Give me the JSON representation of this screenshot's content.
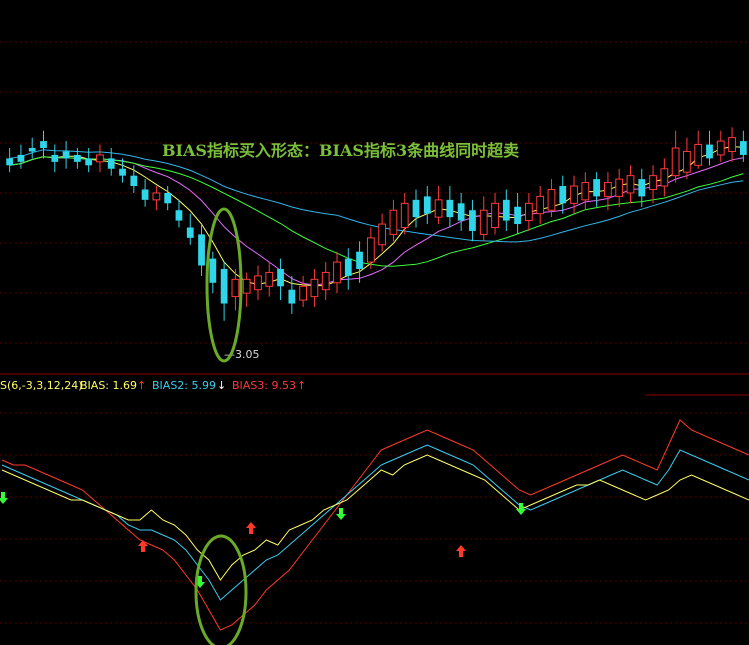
{
  "annotation": {
    "title": "BIAS指标买入形态：BIAS指标3条曲线同时超卖",
    "low_price_label": "—3.05"
  },
  "colors": {
    "background": "#000000",
    "grid": "#5a0000",
    "separator": "#8b0000",
    "candle_up": "#ff3a3a",
    "candle_down": "#2fd5e8",
    "ma_short": "#ffff66",
    "ma_mid": "#e66cff",
    "ma_long": "#3aff3a",
    "ma_longest": "#33b5e8",
    "title_color": "#7cbf3a",
    "ellipse": "#6aaa2a",
    "bias1": "#ffff66",
    "bias2": "#3acdf0",
    "bias3": "#ff3a2a",
    "arrow_up": "#ff3a2a",
    "arrow_down": "#33ff33"
  },
  "indicator_header": {
    "name_params": "S(6,-3,3,12,24)",
    "bias1_label": "BIAS: 1.69",
    "bias1_arrow": "↑",
    "bias2_label": "BIAS2: 5.99",
    "bias2_arrow": "↓",
    "bias3_label": "BIAS3: 9.53",
    "bias3_arrow": "↑"
  },
  "chart_data": [
    {
      "type": "candlestick",
      "title": "BIAS指标买入形态：BIAS指标3条曲线同时超卖",
      "annotation": "3.05",
      "candles": [
        [
          2,
          3.55,
          3.48,
          "d"
        ],
        [
          1,
          3.56,
          3.49,
          "d"
        ],
        [
          0,
          3.58,
          3.52,
          "d"
        ],
        [
          -1,
          3.6,
          3.52,
          "d"
        ],
        [
          1,
          3.56,
          3.48,
          "d"
        ],
        [
          -1,
          3.57,
          3.49,
          "d"
        ],
        [
          0,
          3.55,
          3.49,
          "d"
        ],
        [
          1,
          3.55,
          3.48,
          "d"
        ],
        [
          0,
          3.56,
          3.48,
          "u"
        ],
        [
          0,
          3.55,
          3.47,
          "d"
        ],
        [
          1,
          3.52,
          3.45,
          "d"
        ],
        [
          2,
          3.5,
          3.42,
          "d"
        ],
        [
          3,
          3.46,
          3.38,
          "d"
        ],
        [
          3,
          3.44,
          3.37,
          "u"
        ],
        [
          3,
          3.44,
          3.37,
          "d"
        ],
        [
          4,
          3.4,
          3.32,
          "d"
        ],
        [
          5,
          3.36,
          3.27,
          "d"
        ],
        [
          7,
          3.33,
          3.18,
          "d"
        ],
        [
          8,
          3.25,
          3.13,
          "d"
        ],
        [
          9,
          3.22,
          3.05,
          "d"
        ],
        [
          8,
          3.2,
          3.08,
          "u"
        ],
        [
          8,
          3.19,
          3.09,
          "u"
        ],
        [
          8,
          3.21,
          3.11,
          "u"
        ],
        [
          8,
          3.22,
          3.12,
          "u"
        ],
        [
          7,
          3.23,
          3.11,
          "d"
        ],
        [
          6,
          3.18,
          3.07,
          "d"
        ],
        [
          7,
          3.18,
          3.09,
          "u"
        ],
        [
          6,
          3.2,
          3.09,
          "u"
        ],
        [
          5,
          3.22,
          3.11,
          "u"
        ],
        [
          4,
          3.25,
          3.13,
          "u"
        ],
        [
          5,
          3.26,
          3.14,
          "d"
        ],
        [
          6,
          3.28,
          3.16,
          "d"
        ],
        [
          7,
          3.32,
          3.2,
          "u"
        ],
        [
          8,
          3.36,
          3.25,
          "u"
        ],
        [
          9,
          3.4,
          3.28,
          "u"
        ],
        [
          10,
          3.42,
          3.3,
          "u"
        ],
        [
          11,
          3.43,
          3.32,
          "d"
        ],
        [
          12,
          3.44,
          3.33,
          "d"
        ],
        [
          11,
          3.44,
          3.33,
          "u"
        ],
        [
          11,
          3.44,
          3.32,
          "d"
        ],
        [
          11,
          3.42,
          3.31,
          "d"
        ],
        [
          10,
          3.4,
          3.28,
          "d"
        ],
        [
          9,
          3.41,
          3.28,
          "u"
        ],
        [
          9,
          3.42,
          3.3,
          "u"
        ],
        [
          9,
          3.43,
          3.31,
          "d"
        ],
        [
          8,
          3.42,
          3.3,
          "d"
        ],
        [
          8,
          3.42,
          3.31,
          "u"
        ],
        [
          7,
          3.44,
          3.33,
          "u"
        ],
        [
          7,
          3.46,
          3.35,
          "u"
        ],
        [
          6,
          3.47,
          3.36,
          "d"
        ],
        [
          6,
          3.47,
          3.36,
          "u"
        ],
        [
          5,
          3.48,
          3.37,
          "u"
        ],
        [
          5,
          3.48,
          3.38,
          "d"
        ],
        [
          5,
          3.48,
          3.37,
          "u"
        ],
        [
          4,
          3.49,
          3.38,
          "u"
        ],
        [
          4,
          3.5,
          3.39,
          "u"
        ],
        [
          4,
          3.49,
          3.38,
          "d"
        ],
        [
          3,
          3.5,
          3.39,
          "u"
        ],
        [
          3,
          3.52,
          3.41,
          "u"
        ],
        [
          1,
          3.6,
          3.45,
          "u"
        ],
        [
          2,
          3.58,
          3.46,
          "u"
        ],
        [
          2,
          3.6,
          3.49,
          "u"
        ],
        [
          1,
          3.6,
          3.5,
          "d"
        ],
        [
          1,
          3.6,
          3.51,
          "u"
        ],
        [
          1,
          3.61,
          3.51,
          "u"
        ],
        [
          0,
          3.6,
          3.51,
          "d"
        ]
      ],
      "candle_bodies": [
        [
          3.52,
          3.5
        ],
        [
          3.53,
          3.51
        ],
        [
          3.55,
          3.54
        ],
        [
          3.57,
          3.55
        ],
        [
          3.53,
          3.51
        ],
        [
          3.54,
          3.52
        ],
        [
          3.53,
          3.51
        ],
        [
          3.52,
          3.5
        ],
        [
          3.51,
          3.53
        ],
        [
          3.52,
          3.49
        ],
        [
          3.49,
          3.47
        ],
        [
          3.47,
          3.44
        ],
        [
          3.43,
          3.4
        ],
        [
          3.4,
          3.42
        ],
        [
          3.42,
          3.39
        ],
        [
          3.37,
          3.34
        ],
        [
          3.32,
          3.29
        ],
        [
          3.3,
          3.21
        ],
        [
          3.23,
          3.16
        ],
        [
          3.2,
          3.1
        ],
        [
          3.12,
          3.17
        ],
        [
          3.13,
          3.17
        ],
        [
          3.14,
          3.18
        ],
        [
          3.15,
          3.19
        ],
        [
          3.2,
          3.15
        ],
        [
          3.14,
          3.1
        ],
        [
          3.11,
          3.15
        ],
        [
          3.12,
          3.17
        ],
        [
          3.14,
          3.19
        ],
        [
          3.16,
          3.22
        ],
        [
          3.23,
          3.18
        ],
        [
          3.25,
          3.2
        ],
        [
          3.22,
          3.29
        ],
        [
          3.27,
          3.33
        ],
        [
          3.3,
          3.37
        ],
        [
          3.32,
          3.39
        ],
        [
          3.4,
          3.35
        ],
        [
          3.41,
          3.36
        ],
        [
          3.35,
          3.4
        ],
        [
          3.4,
          3.35
        ],
        [
          3.39,
          3.34
        ],
        [
          3.37,
          3.31
        ],
        [
          3.3,
          3.37
        ],
        [
          3.32,
          3.39
        ],
        [
          3.4,
          3.34
        ],
        [
          3.38,
          3.33
        ],
        [
          3.34,
          3.39
        ],
        [
          3.36,
          3.41
        ],
        [
          3.37,
          3.43
        ],
        [
          3.44,
          3.39
        ],
        [
          3.39,
          3.44
        ],
        [
          3.4,
          3.45
        ],
        [
          3.46,
          3.41
        ],
        [
          3.41,
          3.45
        ],
        [
          3.41,
          3.46
        ],
        [
          3.42,
          3.47
        ],
        [
          3.46,
          3.41
        ],
        [
          3.43,
          3.47
        ],
        [
          3.44,
          3.49
        ],
        [
          3.47,
          3.55
        ],
        [
          3.48,
          3.54
        ],
        [
          3.5,
          3.56
        ],
        [
          3.56,
          3.52
        ],
        [
          3.53,
          3.57
        ],
        [
          3.54,
          3.58
        ],
        [
          3.57,
          3.53
        ]
      ]
    },
    {
      "type": "line",
      "series": [
        {
          "name": "BIAS",
          "values": [
            4,
            3,
            2,
            1,
            0,
            -1,
            -2,
            -2,
            -3,
            -4,
            -5,
            -6,
            -6,
            -4,
            -6,
            -7,
            -9,
            -12,
            -14,
            -18,
            -15,
            -13,
            -12,
            -10,
            -11,
            -8,
            -7,
            -6,
            -4,
            -3,
            -2,
            0,
            2,
            4,
            3,
            5,
            6,
            7,
            6,
            5,
            4,
            3,
            2,
            0,
            -2,
            -4,
            -3,
            -2,
            -1,
            0,
            1,
            1,
            2,
            1,
            0,
            -1,
            -2,
            -1,
            0,
            2,
            3,
            2,
            1,
            0,
            -1,
            -2
          ]
        },
        {
          "name": "BIAS2",
          "values": [
            5,
            4,
            3,
            2,
            1,
            0,
            -1,
            -2,
            -3,
            -4,
            -5,
            -7,
            -8,
            -8,
            -9,
            -10,
            -12,
            -15,
            -18,
            -22,
            -20,
            -18,
            -16,
            -14,
            -13,
            -11,
            -9,
            -7,
            -5,
            -3,
            -1,
            1,
            3,
            5,
            6,
            7,
            8,
            9,
            8,
            7,
            6,
            5,
            3,
            1,
            -1,
            -3,
            -4,
            -3,
            -2,
            -1,
            0,
            1,
            2,
            3,
            4,
            3,
            2,
            1,
            4,
            8,
            7,
            6,
            5,
            4,
            3,
            2
          ]
        },
        {
          "name": "BIAS3",
          "values": [
            6,
            5,
            5,
            4,
            3,
            2,
            1,
            0,
            -2,
            -4,
            -6,
            -8,
            -10,
            -11,
            -12,
            -14,
            -17,
            -20,
            -24,
            -28,
            -27,
            -25,
            -23,
            -20,
            -18,
            -16,
            -13,
            -10,
            -7,
            -4,
            -1,
            2,
            5,
            8,
            9,
            10,
            11,
            12,
            11,
            10,
            9,
            8,
            6,
            4,
            2,
            0,
            -1,
            0,
            1,
            2,
            3,
            4,
            5,
            6,
            7,
            6,
            5,
            4,
            9,
            14,
            12,
            11,
            10,
            9,
            8,
            7
          ]
        }
      ]
    }
  ]
}
